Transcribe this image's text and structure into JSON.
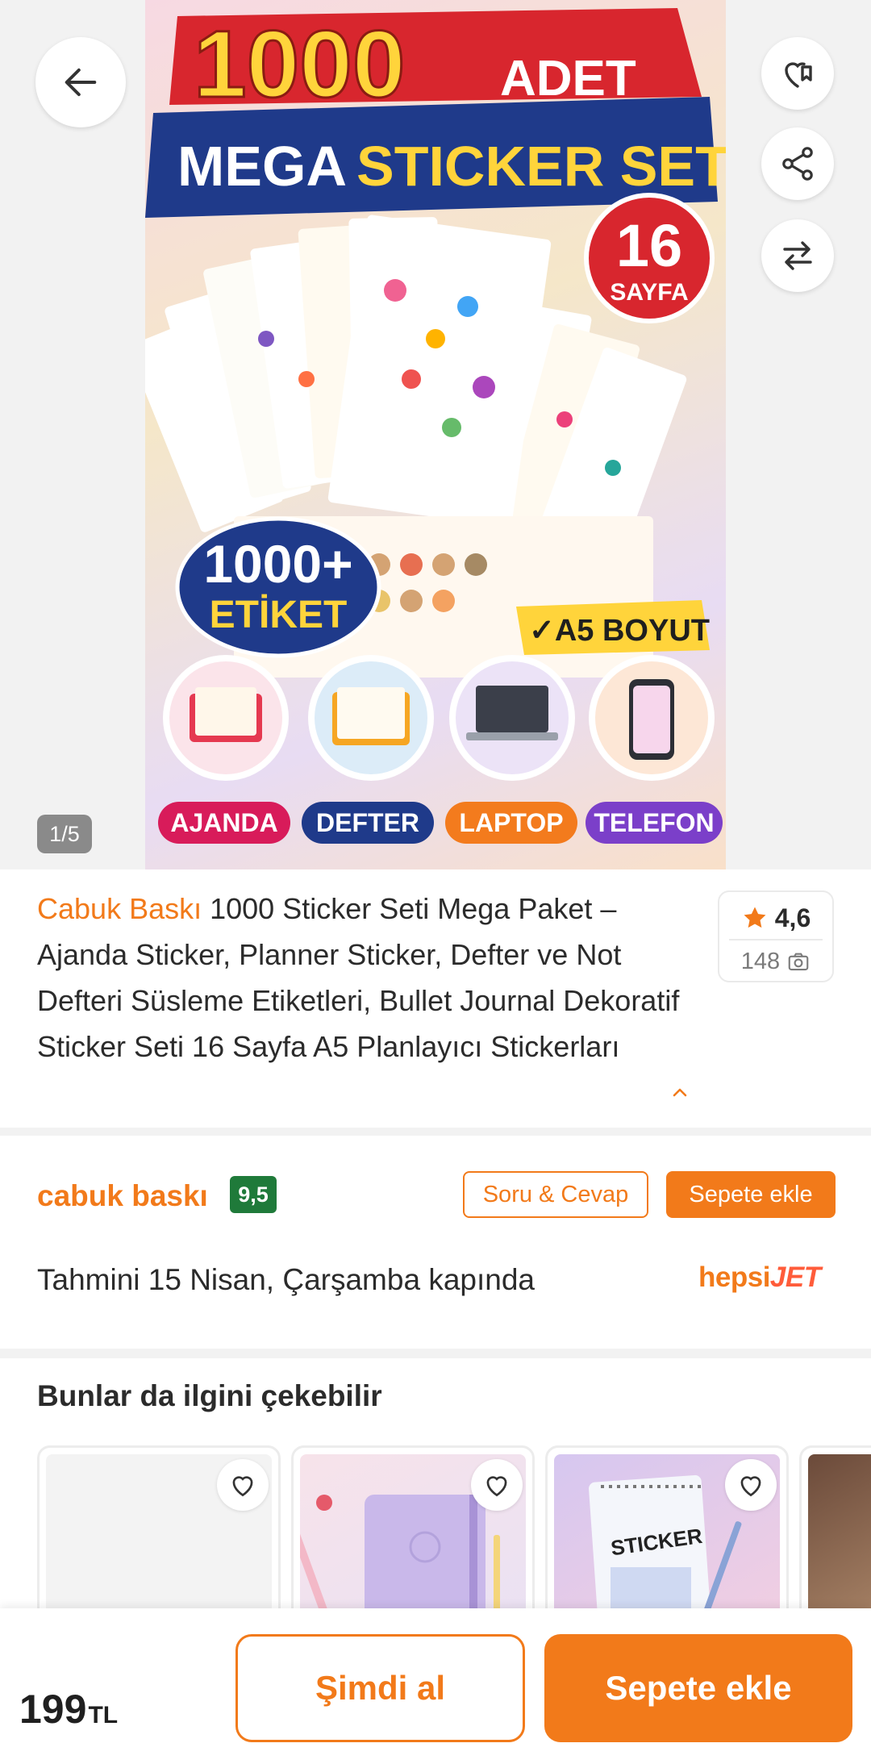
{
  "gallery": {
    "pager": "1/5",
    "image": {
      "headline_number": "1000",
      "headline_unit": "ADET",
      "headline_sub_1": "MEGA",
      "headline_sub_2": "STICKER SETİ",
      "badge_pages_number": "16",
      "badge_pages_label": "SAYFA",
      "badge_labels_number": "1000+",
      "badge_labels_label": "ETİKET",
      "badge_size": "✓A5 BOYUT",
      "use_cases": [
        "AJANDA",
        "DEFTER",
        "LAPTOP",
        "TELEFON"
      ]
    }
  },
  "product": {
    "brand": "Cabuk Baskı",
    "title": " 1000 Sticker Seti Mega Paket – Ajanda Sticker, Planner Sticker, Defter ve Not Defteri Süsleme Etiketleri, Bullet Journal Dekoratif Sticker Seti 16 Sayfa A5 Planlayıcı Stickerları",
    "rating": "4,6",
    "review_count": "148"
  },
  "seller": {
    "name": "cabuk baskı",
    "score": "9,5",
    "qa_label": "Soru & Cevap",
    "add_to_cart_label": "Sepete ekle",
    "delivery": "Tahmini 15 Nisan, Çarşamba kapında",
    "carrier_part1": "hepsi",
    "carrier_part2": "JET"
  },
  "recommendations": {
    "title": "Bunlar da ilgini çekebilir",
    "card3_text": "STICKER"
  },
  "bottom_bar": {
    "price": "199",
    "currency": "TL",
    "buy_now": "Şimdi al",
    "add_to_cart": "Sepete ekle"
  },
  "colors": {
    "accent": "#f27a1a",
    "score_badge": "#1f7a3a",
    "star": "#f27a1a"
  }
}
